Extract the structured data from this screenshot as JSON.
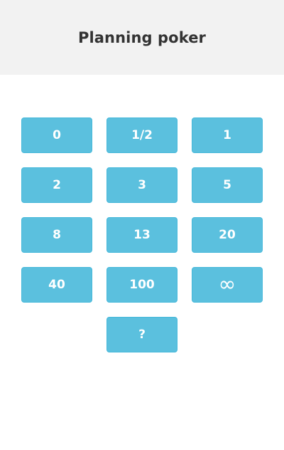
{
  "app": {
    "title": "Planning poker"
  },
  "cards": [
    {
      "id": "0",
      "label": "0"
    },
    {
      "id": "half",
      "label": "1/2"
    },
    {
      "id": "1",
      "label": "1"
    },
    {
      "id": "2",
      "label": "2"
    },
    {
      "id": "3",
      "label": "3"
    },
    {
      "id": "5",
      "label": "5"
    },
    {
      "id": "8",
      "label": "8"
    },
    {
      "id": "13",
      "label": "13"
    },
    {
      "id": "20",
      "label": "20"
    },
    {
      "id": "40",
      "label": "40"
    },
    {
      "id": "100",
      "label": "100"
    },
    {
      "id": "infinity",
      "label": "∞"
    },
    {
      "id": "question",
      "label": "?"
    }
  ],
  "colors": {
    "header_bg": "#f2f2f2",
    "card_bg": "#5bc0de",
    "card_border": "#46b8da",
    "card_text": "#ffffff",
    "title_text": "#333333"
  }
}
